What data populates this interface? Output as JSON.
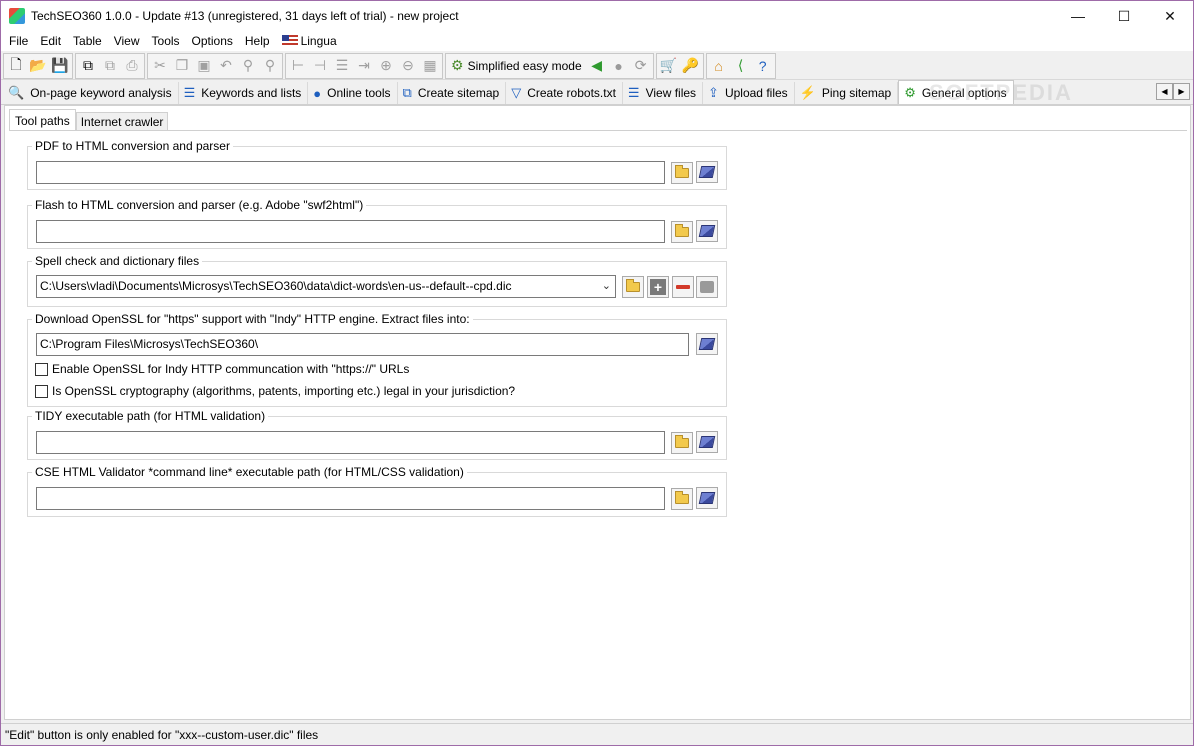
{
  "window": {
    "title": "TechSEO360 1.0.0 - Update #13 (unregistered, 31 days left of trial) - new project",
    "controls": {
      "minimize": "—",
      "maximize": "☐",
      "close": "✕"
    }
  },
  "menu": {
    "items": [
      "File",
      "Edit",
      "Table",
      "View",
      "Tools",
      "Options",
      "Help"
    ],
    "lingua": "Lingua"
  },
  "toolbar": {
    "simplified_mode": "Simplified easy mode"
  },
  "main_tabs": [
    {
      "label": "On-page keyword analysis",
      "icon": "search-icon"
    },
    {
      "label": "Keywords and lists",
      "icon": "list-icon"
    },
    {
      "label": "Online tools",
      "icon": "globe-icon"
    },
    {
      "label": "Create sitemap",
      "icon": "sitemap-icon"
    },
    {
      "label": "Create robots.txt",
      "icon": "filter-icon"
    },
    {
      "label": "View files",
      "icon": "list-icon"
    },
    {
      "label": "Upload files",
      "icon": "upload-icon"
    },
    {
      "label": "Ping sitemap",
      "icon": "lightning-icon"
    },
    {
      "label": "General options",
      "icon": "gears-icon"
    }
  ],
  "watermark": "SOFTPEDIA",
  "sub_tabs": [
    "Tool paths",
    "Internet crawler"
  ],
  "groups": {
    "pdf": {
      "label": "PDF to HTML conversion and parser",
      "value": ""
    },
    "flash": {
      "label": "Flash to HTML conversion and parser (e.g. Adobe \"swf2html\")",
      "value": ""
    },
    "spell": {
      "label": "Spell check and dictionary files",
      "value": "C:\\Users\\vladi\\Documents\\Microsys\\TechSEO360\\data\\dict-words\\en-us--default--cpd.dic"
    },
    "openssl": {
      "label": "Download OpenSSL for \"https\" support with \"Indy\" HTTP engine. Extract files into:",
      "value": "C:\\Program Files\\Microsys\\TechSEO360\\",
      "check1": "Enable OpenSSL for Indy HTTP communcation with \"https://\" URLs",
      "check2": "Is OpenSSL cryptography (algorithms, patents, importing etc.) legal in your jurisdiction?"
    },
    "tidy": {
      "label": "TIDY executable path (for HTML validation)",
      "value": ""
    },
    "cse": {
      "label": "CSE HTML Validator *command line* executable path (for HTML/CSS validation)",
      "value": ""
    }
  },
  "status": "\"Edit\" button is only enabled for \"xxx--custom-user.dic\" files"
}
